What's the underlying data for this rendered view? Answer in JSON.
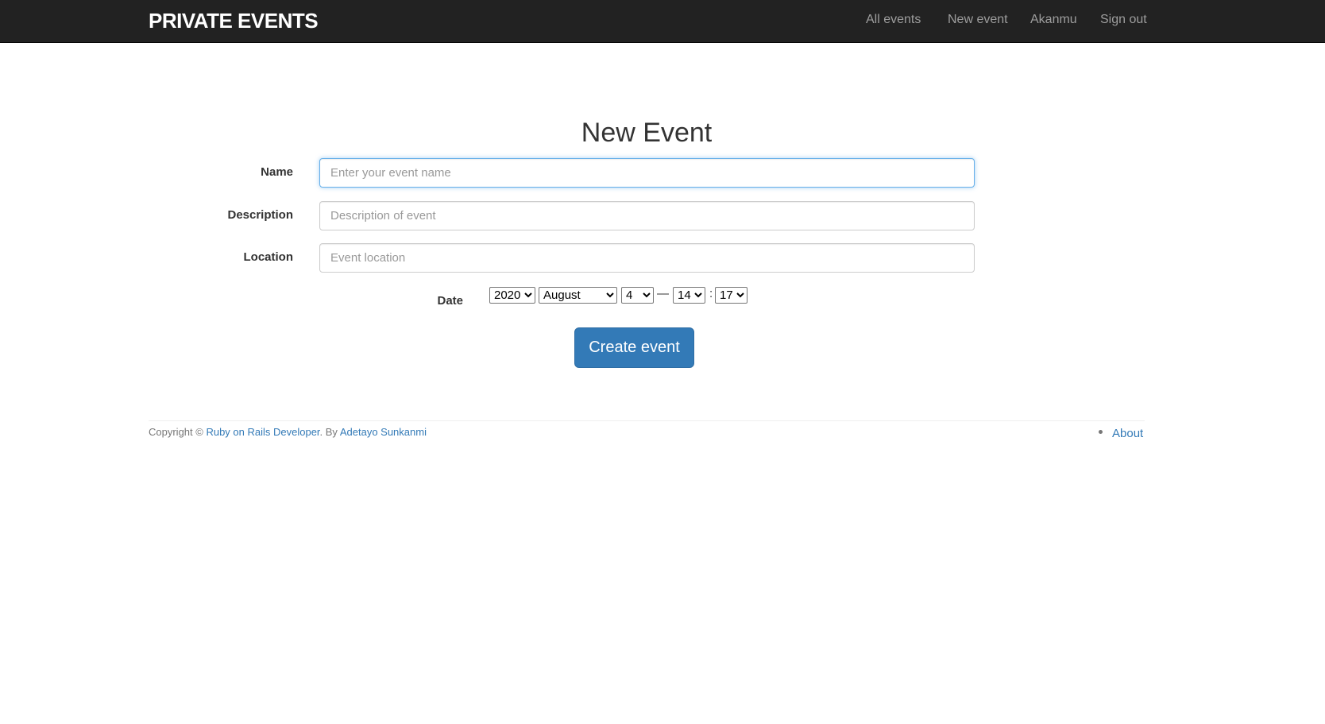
{
  "navbar": {
    "brand": "PRIVATE EVENTS",
    "links": [
      "All events",
      "New event",
      "Akanmu",
      "Sign out"
    ]
  },
  "page": {
    "title": "New Event"
  },
  "form": {
    "name": {
      "label": "Name",
      "value": "",
      "placeholder": "Enter your event name"
    },
    "description": {
      "label": "Description",
      "value": "",
      "placeholder": "Description of event"
    },
    "location": {
      "label": "Location",
      "value": "",
      "placeholder": "Event location"
    },
    "date": {
      "label": "Date",
      "year": "2020",
      "month": "August",
      "day": "4",
      "dash": "—",
      "hour": "14",
      "colon": ":",
      "minute": "17"
    },
    "submit_label": "Create event"
  },
  "footer": {
    "copyright_prefix": "Copyright ©",
    "developer_link": "Ruby on Rails Developer",
    "by_text": ". By",
    "author_link": "Adetayo Sunkanmi",
    "about_link": "About"
  },
  "colors": {
    "navbar_bg": "#222222",
    "link": "#337ab7",
    "button_primary": "#337ab7",
    "focus_border": "#66afe9"
  }
}
